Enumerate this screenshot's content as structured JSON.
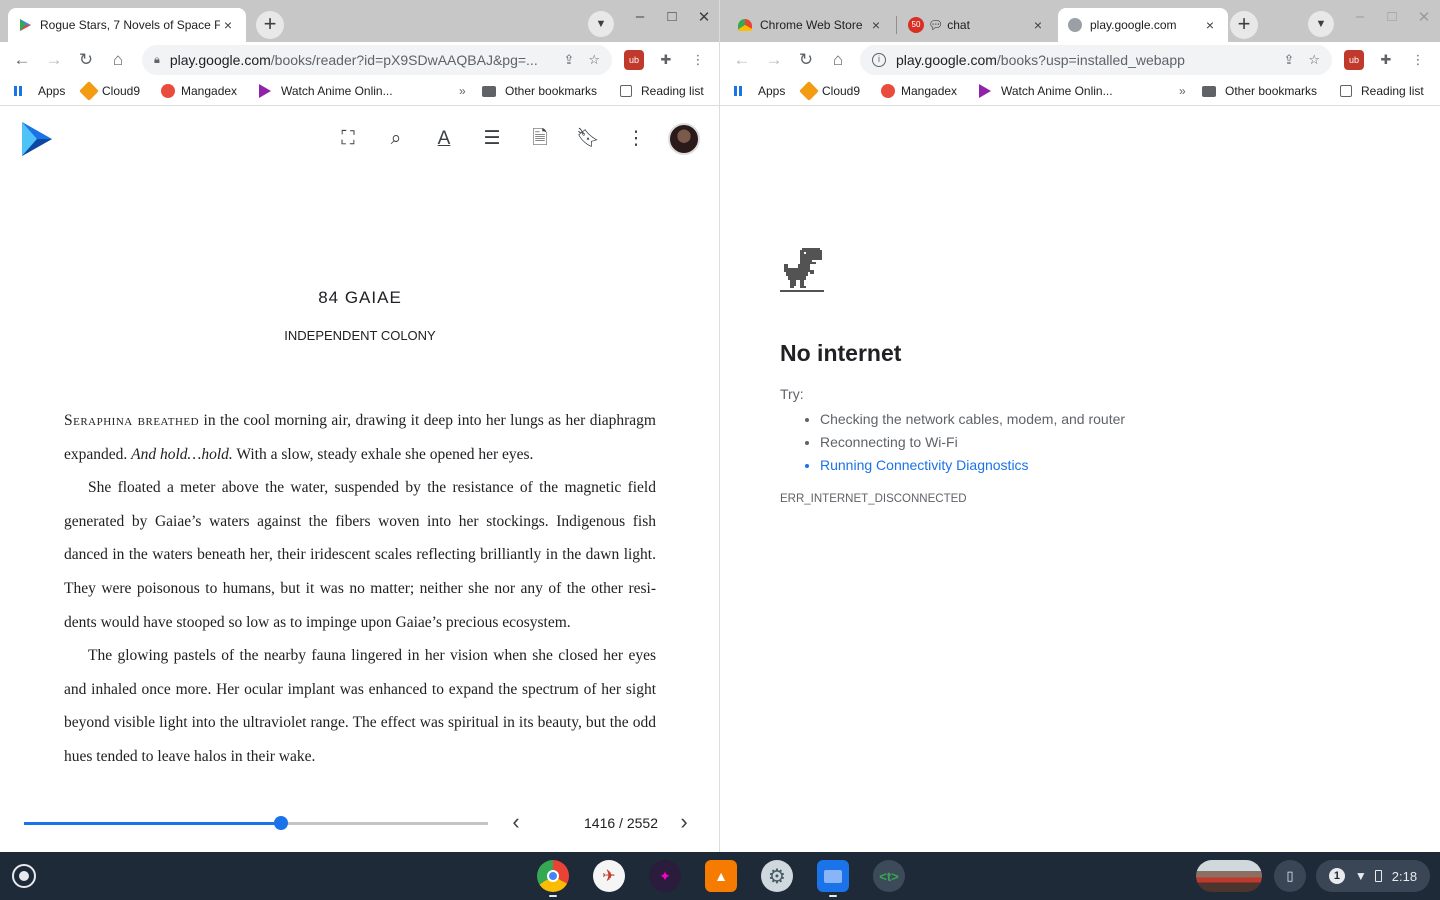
{
  "left_window": {
    "tab": {
      "title": "Rogue Stars, 7 Novels of Space F",
      "close": "×"
    },
    "new_tab": "+",
    "tab_search": "⌄",
    "window_controls": [
      "–",
      "□",
      "✕"
    ],
    "url_host": "play.google.com",
    "url_path": "/books/reader?id=pX9SDwAAQBAJ&pg=...",
    "bookmarks": {
      "apps": "Apps",
      "cloud9": "Cloud9",
      "mangadex": "Mangadex",
      "anime": "Watch Anime Onlin...",
      "more": "»",
      "other": "Other bookmarks",
      "reading_list": "Reading list"
    }
  },
  "right_window": {
    "tabs": [
      {
        "title": "Chrome Web Store",
        "close": "×"
      },
      {
        "title": "chat",
        "badge": "50",
        "close": "×"
      },
      {
        "title": "play.google.com",
        "close": "×"
      }
    ],
    "new_tab": "+",
    "tab_search": "⌄",
    "window_controls": [
      "–",
      "□",
      "✕"
    ],
    "url_host": "play.google.com",
    "url_path": "/books?usp=installed_webapp",
    "bookmarks": {
      "apps": "Apps",
      "cloud9": "Cloud9",
      "mangadex": "Mangadex",
      "anime": "Watch Anime Onlin...",
      "more": "»",
      "other": "Other bookmarks",
      "reading_list": "Reading list"
    }
  },
  "reader": {
    "header": "84   GAIAE",
    "subheader": "INDEPENDENT COLONY",
    "p1_smallcaps": "Seraphina breathed",
    "p1_text1": " in the cool morning air, drawing it deep into her lungs as her di­aphragm expanded. ",
    "p1_italic": "And hold…hold.",
    "p1_text2": " With a slow, steady exhale she opened her eyes.",
    "p2": "She floated a meter above the water, suspended by the resistance of the magnetic field generated by Gaiae’s waters against the fibers woven into her stockings. Indigenous fish danced in the waters beneath her, their iridescent scales reflecting brilliantly in the dawn light. They were poisonous to humans, but it was no matter; neither she nor any of the other resi­dents would have stooped so low as to impinge upon Gaiae’s precious ecosystem.",
    "p3": "The glowing pastels of the nearby fauna lingered in her vision when she closed her eyes and inhaled once more. Her ocular implant was enhanced to expand the spectrum of her sight beyond visible light into the ultraviolet range. The effect was spiritual in its beauty, but the odd hues tended to leave halos in their wake.",
    "current_page": 1416,
    "total_pages": 2552,
    "page_label": "1416 / 2552",
    "prev": "‹",
    "next": "›",
    "icons": [
      "fullscreen-icon",
      "search-icon",
      "text-format-icon",
      "table-of-contents-icon",
      "notes-icon",
      "bookmark-icon",
      "more-vert-icon"
    ]
  },
  "error_page": {
    "title": "No internet",
    "try_label": "Try:",
    "suggestions": [
      "Checking the network cables, modem, and router",
      "Reconnecting to Wi-Fi",
      "Running Connectivity Diagnostics"
    ],
    "code": "ERR_INTERNET_DISCONNECTED"
  },
  "shelf": {
    "apps": [
      "chrome",
      "flight-game",
      "galaxy",
      "vlc",
      "settings",
      "files",
      "terminal"
    ],
    "notification_count": "1",
    "time": "2:18"
  },
  "colors": {
    "accent": "#1a73e8",
    "shelf": "#1f2a38",
    "tabstrip": "#c7c7c7"
  }
}
